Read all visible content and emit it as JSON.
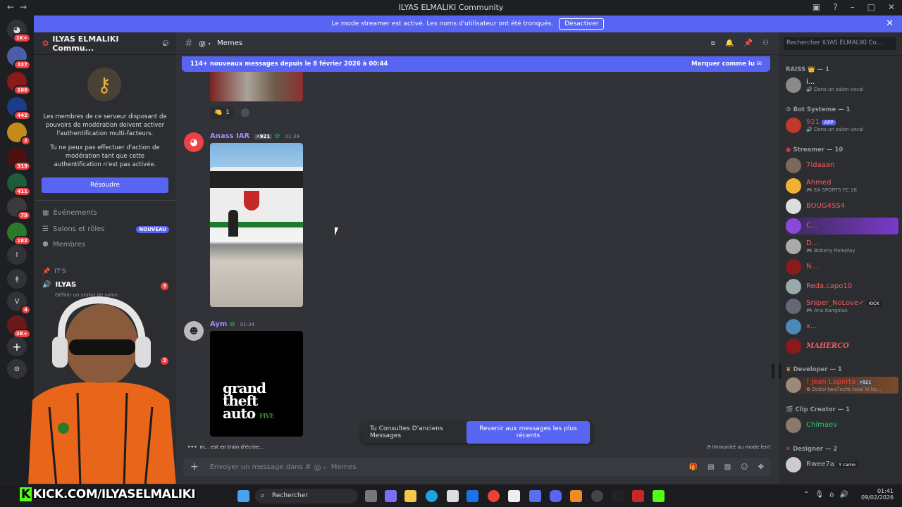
{
  "window": {
    "title": "ILYAS ELMALIKI Community"
  },
  "banner": {
    "text": "Le mode streamer est activé. Les noms d'utilisateur ont été tronqués.",
    "button": "Désactiver"
  },
  "guild_badges": [
    "1K+",
    "337",
    "106",
    "442",
    "2",
    "319",
    "411",
    "79",
    "182",
    "4",
    "2K+"
  ],
  "server": {
    "name": "ILYAS ELMALIKI Commu...",
    "mfa_text_1": "Les membres de ce serveur disposant de pouvoirs de modération doivent activer l'authentification multi-facteurs.",
    "mfa_text_2": "Tu ne peux pas effectuer d'action de modération tant que cette authentification n'est pas activée.",
    "resolve_button": "Résoudre"
  },
  "nav": {
    "events": "Événements",
    "channels_roles": "Salons et rôles",
    "new_badge": "NOUVEAU",
    "members": "Membres",
    "category": "IT'S",
    "voice_channel": "ILYAS",
    "voice_status": "Définir un statut de salon",
    "channel_badge": "3"
  },
  "channel": {
    "name": "Memes",
    "search_placeholder": "Rechercher ILYAS ELMALIKI Co..."
  },
  "new_messages": {
    "text": "114+ nouveaux messages depuis le 8 février 2026 à 00:44",
    "mark_read": "Marquer comme lu"
  },
  "messages": [
    {
      "author": "Anass IAR",
      "tag": "921",
      "time": "01:34"
    },
    {
      "author": "Aym",
      "time": "01:34"
    }
  ],
  "reaction_count": "1",
  "gta": {
    "line1": "grand",
    "line2": "theft",
    "line3": "auto",
    "five": "FIVE"
  },
  "jump": {
    "text": "Tu Consultes D'anciens Messages",
    "button": "Revenir aux messages les plus récents"
  },
  "typing": "m... est en train d'écrire...",
  "slowmode": "Immunité au mode lent",
  "composer_placeholder": "Envoyer un message dans #",
  "composer_channel": "Memes",
  "members": {
    "raiss": "RAISS 👑 — 1",
    "raiss_user": "i...",
    "raiss_status": "Dans un salon vocal",
    "bot_cat": "Bot Systeme — 1",
    "bot_user": "921",
    "bot_tag": "APP",
    "bot_status": "Dans un salon vocal",
    "streamer_cat": "Streamer — 10",
    "list": [
      {
        "name": "7idaaan",
        "status": ""
      },
      {
        "name": "Ahmed",
        "status": "EA SPORTS FC 26"
      },
      {
        "name": "BOUG4SS4",
        "status": ""
      },
      {
        "name": "C...",
        "status": ""
      },
      {
        "name": "D...",
        "status": "Bobony Roleplay"
      },
      {
        "name": "N...",
        "status": ""
      },
      {
        "name": "Reda.capo10",
        "status": ""
      },
      {
        "name": "Sniper_NoLove✓",
        "status": "Ana Kangolak",
        "tag": "KICK"
      },
      {
        "name": "x...",
        "status": ""
      },
      {
        "name": "MAHERCO",
        "status": ""
      }
    ],
    "dev_cat": "Developer — 1",
    "dev_user": "! Jean Laporta",
    "dev_tag": "921",
    "dev_status": "Zebbi twa7echt rassi ki ko...",
    "clip_cat": "Clip Creator — 1",
    "clip_user": "Chimaev",
    "designer_cat": "Designer — 2",
    "designer_user": "Rwee7a",
    "designer_tag": "camo"
  },
  "taskbar": {
    "search": "Rechercher",
    "time": "01:41",
    "date": "09/02/2026"
  },
  "overlay": {
    "kick_url": "KICK.COM/ILYASELMALIKI"
  }
}
